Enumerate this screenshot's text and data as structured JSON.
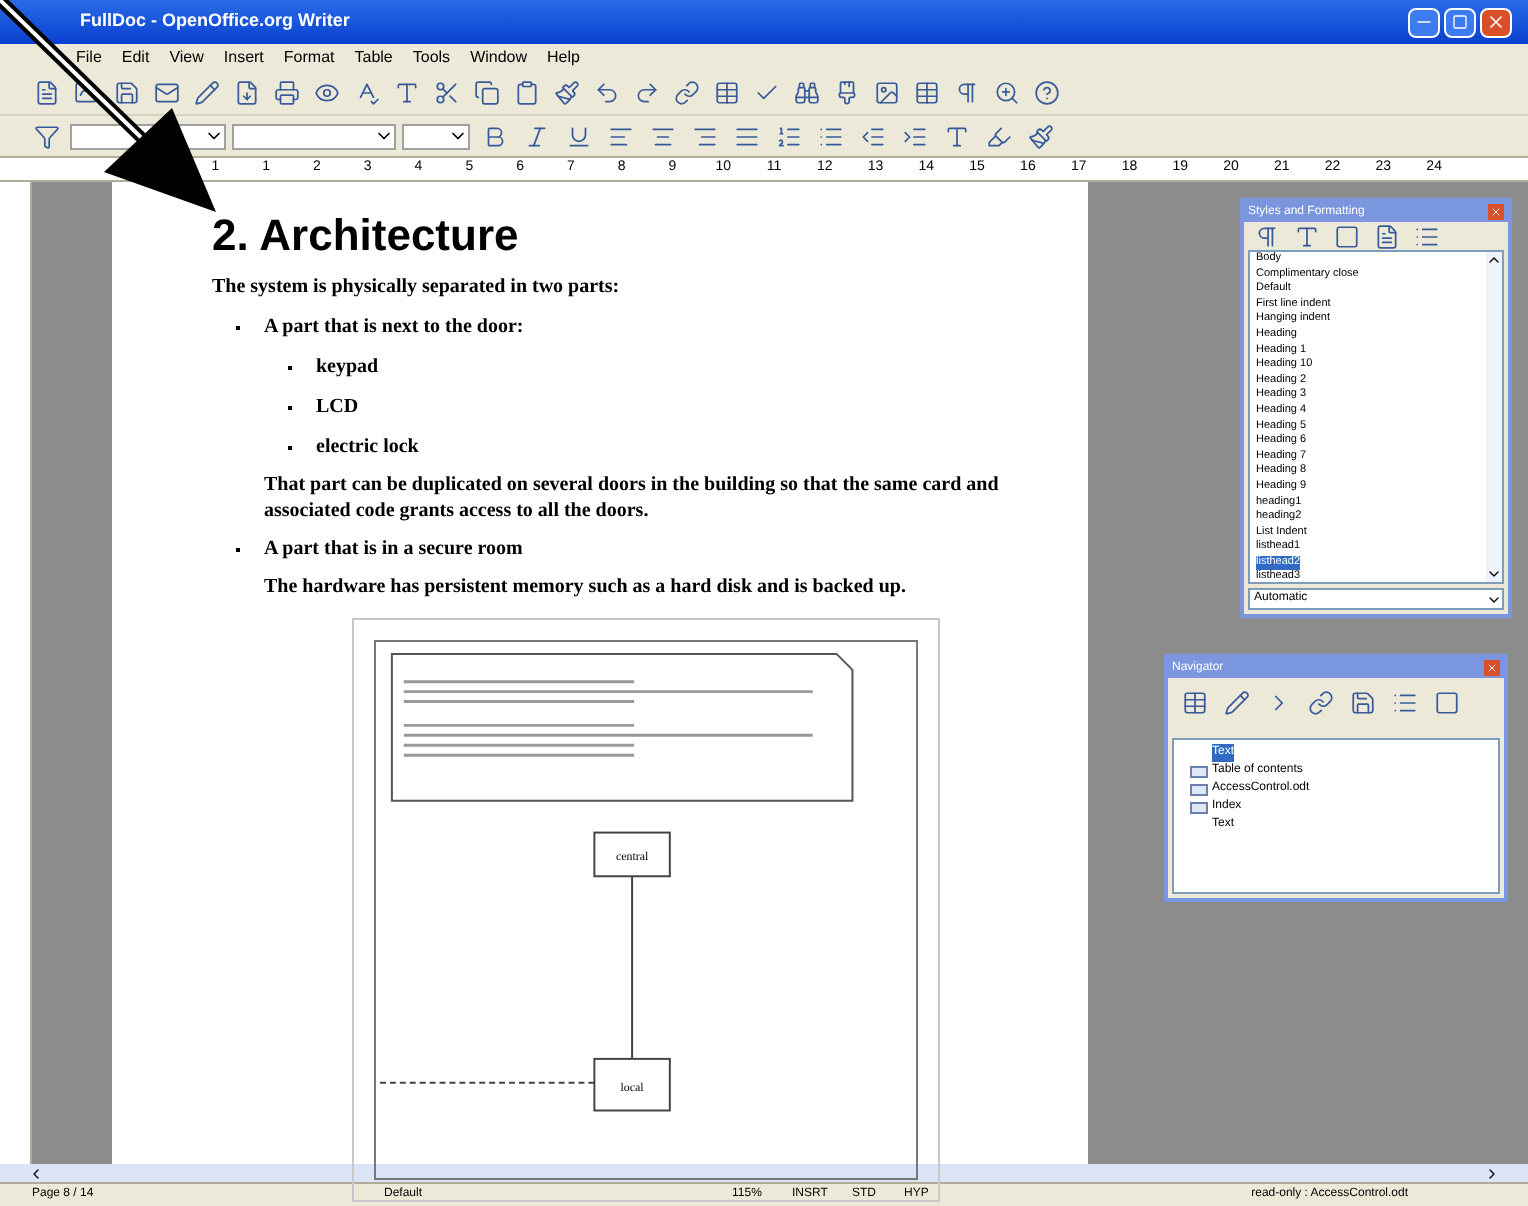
{
  "window": {
    "title": "FullDoc - OpenOffice.org Writer"
  },
  "menu": [
    "File",
    "Edit",
    "View",
    "Insert",
    "Format",
    "Table",
    "Tools",
    "Window",
    "Help"
  ],
  "ruler": {
    "numbers": [
      "1",
      "1",
      "2",
      "3",
      "4",
      "5",
      "6",
      "7",
      "8",
      "9",
      "10",
      "11",
      "12",
      "13",
      "14",
      "15",
      "16",
      "17",
      "18",
      "19",
      "20",
      "21",
      "22",
      "23",
      "24"
    ]
  },
  "document": {
    "heading": "2. Architecture",
    "intro": "The system is physically separated in two parts:",
    "items": [
      {
        "text": "A part that is next to the door:",
        "children": [
          {
            "text": "keypad"
          },
          {
            "text": "LCD"
          },
          {
            "text": "electric lock"
          }
        ],
        "note": "That part can be duplicated on several doors in the building so that the same card and associated code grants access to all the doors."
      },
      {
        "text": "A part that is in a secure room",
        "note": "The hardware has persistent memory such as a hard disk and is backed up."
      }
    ],
    "diagram": {
      "nodes": [
        "central",
        "local"
      ]
    }
  },
  "styles_panel": {
    "title": "Styles and Formatting",
    "items": [
      {
        "label": "Body",
        "selected": false
      },
      {
        "label": "Complimentary close",
        "selected": false
      },
      {
        "label": "Default",
        "selected": false
      },
      {
        "label": "First line indent",
        "selected": false
      },
      {
        "label": "Hanging indent",
        "selected": false
      },
      {
        "label": "Heading",
        "selected": false
      },
      {
        "label": "Heading 1",
        "selected": false
      },
      {
        "label": "Heading 10",
        "selected": false
      },
      {
        "label": "Heading 2",
        "selected": false
      },
      {
        "label": "Heading 3",
        "selected": false
      },
      {
        "label": "Heading 4",
        "selected": false
      },
      {
        "label": "Heading 5",
        "selected": false
      },
      {
        "label": "Heading 6",
        "selected": false
      },
      {
        "label": "Heading 7",
        "selected": false
      },
      {
        "label": "Heading 8",
        "selected": false
      },
      {
        "label": "Heading 9",
        "selected": false
      },
      {
        "label": "heading1",
        "selected": false
      },
      {
        "label": "heading2",
        "selected": false
      },
      {
        "label": "List Indent",
        "selected": false
      },
      {
        "label": "listhead1",
        "selected": false
      },
      {
        "label": "listhead2",
        "selected": true
      },
      {
        "label": "listhead3",
        "selected": false
      }
    ],
    "filter": "Automatic"
  },
  "navigator": {
    "title": "Navigator",
    "items": [
      {
        "label": "Text",
        "selected": true,
        "kind": "plain"
      },
      {
        "label": "Table of contents",
        "selected": false,
        "kind": "icon"
      },
      {
        "label": "AccessControl.odt",
        "selected": false,
        "kind": "icon"
      },
      {
        "label": "Index",
        "selected": false,
        "kind": "icon"
      },
      {
        "label": "Text",
        "selected": false,
        "kind": "plain"
      }
    ]
  },
  "status_bar": {
    "page": "Page 8 / 14",
    "style": "Default",
    "zoom": "115%",
    "insert": "INSRT",
    "selection": "STD",
    "hyperlink": "HYP",
    "file": "read-only : AccessControl.odt"
  }
}
